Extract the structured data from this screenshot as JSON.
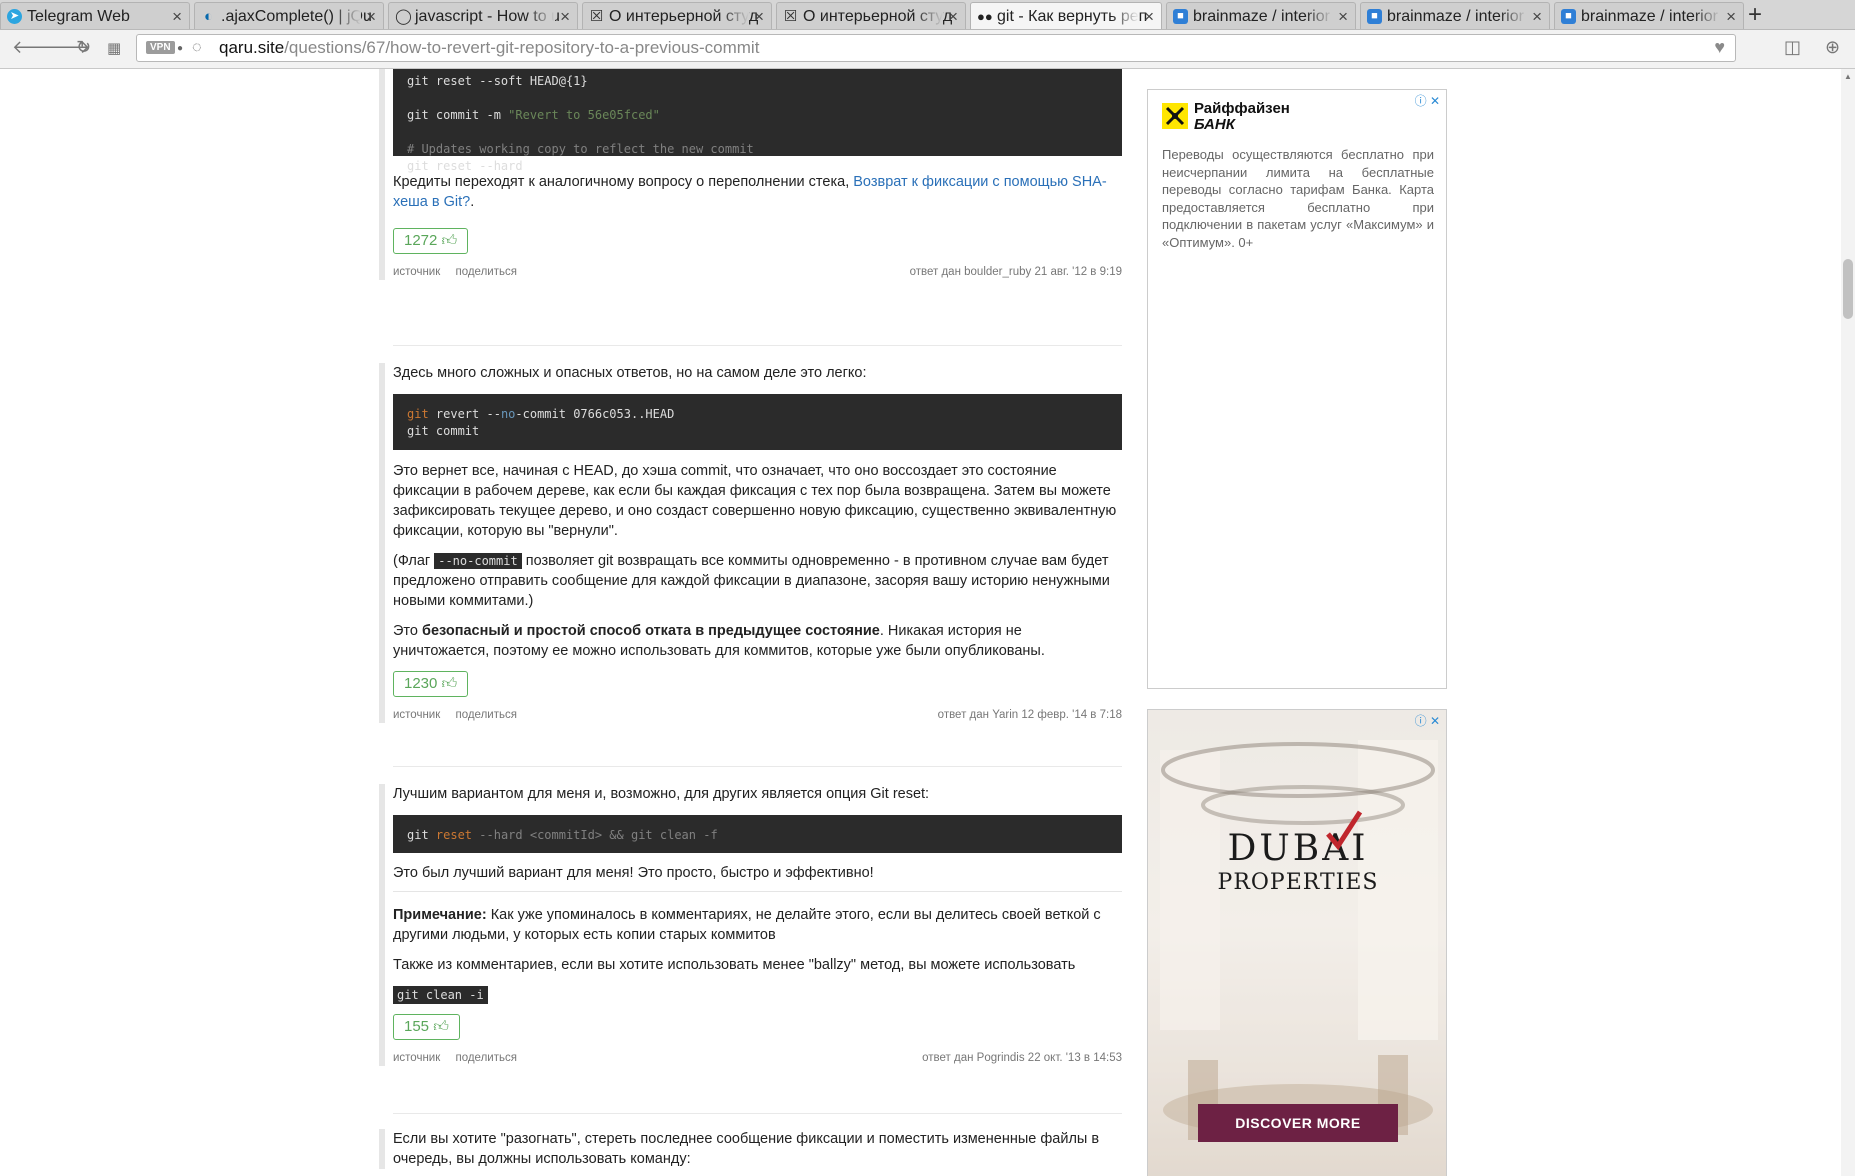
{
  "tabs": [
    {
      "title": "Telegram Web",
      "icon": "telegram-icon",
      "color": "#2ca5e0"
    },
    {
      "title": ".ajaxComplete() | jQu",
      "icon": "jquery-icon",
      "color": "#0769ad"
    },
    {
      "title": "javascript - How to u",
      "icon": "github-icon",
      "color": "#333333"
    },
    {
      "title": "О интерьерной студ",
      "icon": "mail-icon",
      "color": "#444444"
    },
    {
      "title": "О интерьерной студ",
      "icon": "mail-icon",
      "color": "#444444"
    },
    {
      "title": "git - Как вернуть реп",
      "icon": "glasses-icon",
      "color": "#222222"
    },
    {
      "title": "brainmaze / interior",
      "icon": "bitbucket-icon",
      "color": "#205081"
    },
    {
      "title": "brainmaze / interior",
      "icon": "bitbucket-icon",
      "color": "#205081"
    },
    {
      "title": "brainmaze / interior",
      "icon": "bitbucket-icon",
      "color": "#205081"
    }
  ],
  "toolbar": {
    "vpn": "VPN",
    "url_host": "qaru.site",
    "url_path": "/questions/67/how-to-revert-git-repository-to-a-previous-commit"
  },
  "answers": [
    {
      "code_lines": [
        "git reset --soft HEAD@{1}",
        "",
        "git commit -m \"Revert to 56e05fced\"",
        "",
        "# Updates working copy to reflect the new commit",
        "git reset --hard"
      ],
      "credits_text": "Кредиты переходят к аналогичному вопросу о переполнении стека, ",
      "credits_link": "Возврат к фиксации с помощью SHA-хеша в Git?",
      "credits_end": ".",
      "votes": "1272",
      "source": "источник",
      "share": "поделиться",
      "meta": "ответ дан boulder_ruby 21 авг. '12 в 9:19"
    },
    {
      "intro": "Здесь много сложных и опасных ответов, но на самом деле это легко:",
      "p1": "Это вернет все, начиная с HEAD, до хэша commit, что означает, что оно воссоздает это состояние фиксации в рабочем дереве, как если бы каждая фиксация с тех пор была возвращена. Затем вы можете зафиксировать текущее дерево, и оно создаст совершенно новую фиксацию, существенно эквивалентную фиксации, которую вы \"вернули\".",
      "p2_start": "(Флаг ",
      "p2_code": "--no-commit",
      "p2_end": " позволяет git возвращать все коммиты одновременно - в противном случае вам будет предложено отправить сообщение для каждой фиксации в диапазоне, засоряя вашу историю ненужными новыми коммитами.)",
      "p3_start": "Это ",
      "p3_bold": "безопасный и простой способ отката в предыдущее состояние",
      "p3_end": ". Никакая история не уничтожается, поэтому ее можно использовать для коммитов, которые уже были опубликованы.",
      "votes": "1230",
      "source": "источник",
      "share": "поделиться",
      "meta": "ответ дан Yarin 12 февр. '14 в 7:18"
    },
    {
      "intro": "Лучшим вариантом для меня и, возможно, для других является опция Git reset:",
      "p1": "Это был лучший вариант для меня! Это просто, быстро и эффективно!",
      "note_bold": "Примечание:",
      "note_text": " Как уже упоминалось в комментариях, не делайте этого, если вы делитесь своей веткой с другими людьми, у которых есть копии старых коммитов",
      "p2": "Также из комментариев, если вы хотите использовать менее \"ballzy\" метод, вы можете использовать",
      "code2": "git clean -i",
      "votes": "155",
      "source": "источник",
      "share": "поделиться",
      "meta": "ответ дан Pogrindis 22 окт. '13 в 14:53"
    },
    {
      "intro": "Если вы хотите \"разогнать\", стереть последнее сообщение фиксации и поместить измененные файлы в очередь, вы должны использовать команду:"
    }
  ],
  "ad1": {
    "brand_line1": "Райффайзен",
    "brand_line2": "БАНК",
    "text": "Переводы осуществляются бесплатно при неисчерпании лимита на бесплатные переводы согласно тарифам Банка. Карта предоставляется бесплатно при подключении в пакетам услуг «Максимум» и «Оптимум». 0+"
  },
  "ad2": {
    "brand_line1": "DUBAI",
    "brand_line2": "PROPERTIES",
    "cta": "DISCOVER MORE"
  }
}
